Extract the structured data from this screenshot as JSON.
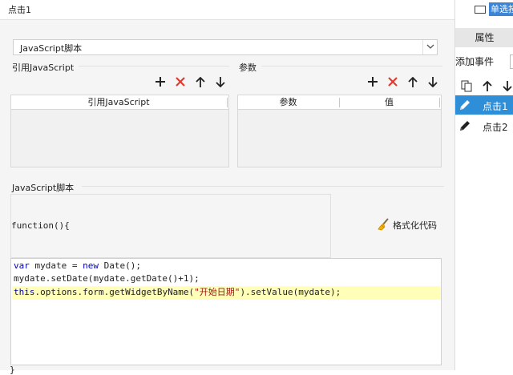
{
  "dialog": {
    "title": "点击1",
    "type_select": {
      "value": "JavaScript脚本"
    },
    "ref_section": {
      "label": "引用JavaScript",
      "column": "引用JavaScript"
    },
    "params_section": {
      "label": "参数",
      "columns": [
        "参数",
        "值"
      ]
    },
    "script_section": {
      "label": "JavaScript脚本"
    },
    "function_header": "function(){",
    "format_button": "格式化代码",
    "code": {
      "line1": {
        "kw1": "var",
        "t1": " mydate = ",
        "kw2": "new",
        "t2": " Date();"
      },
      "line2": "mydate.setDate(mydate.getDate()+1);",
      "line3": {
        "kw1": "this",
        "t1": ".options.form.getWidgetByName(",
        "str": "\"开始日期\"",
        "t2": ").setValue(mydate);"
      }
    },
    "closing": "}"
  },
  "right_panel": {
    "widget_label": "单选按钮组",
    "properties_tab": "属性",
    "add_event_label": "添加事件",
    "events": [
      {
        "label": "点击1",
        "active": true
      },
      {
        "label": "点击2",
        "active": false
      }
    ]
  },
  "icons": [
    "add-icon",
    "delete-icon",
    "move-up-icon",
    "move-down-icon",
    "broom-icon",
    "copy-icon",
    "pencil-icon",
    "radio-widget-icon",
    "chevron-down-icon"
  ],
  "colors": {
    "accent": "#2e8fd8",
    "delete": "#e23b2e",
    "highlight": "#ffffb8",
    "keyword": "#0000cc",
    "string": "#a31515"
  }
}
